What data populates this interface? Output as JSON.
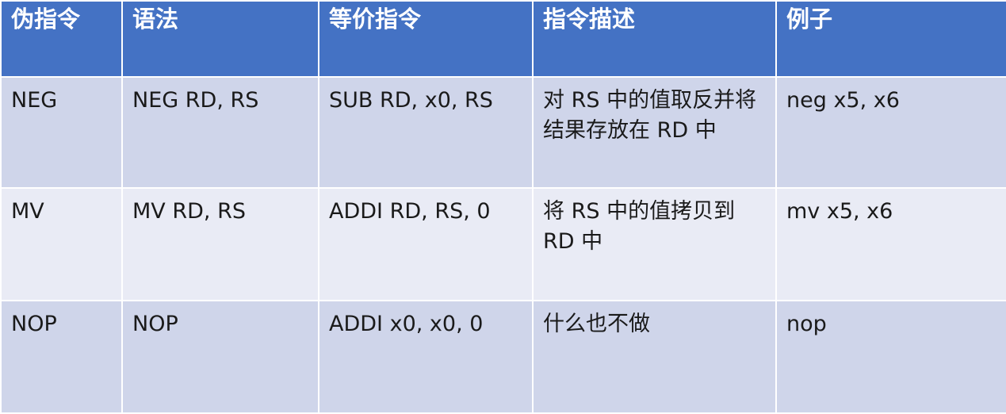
{
  "table": {
    "headers": [
      "伪指令",
      "语法",
      "等价指令",
      "指令描述",
      "例子"
    ],
    "rows": [
      {
        "pseudo": "NEG",
        "syntax": "NEG RD, RS",
        "equivalent": "SUB RD, x0, RS",
        "description": "对 RS 中的值取反并将结果存放在 RD 中",
        "example": "neg x5, x6"
      },
      {
        "pseudo": "MV",
        "syntax": "MV RD, RS",
        "equivalent": "ADDI RD, RS, 0",
        "description": "将 RS 中的值拷贝到 RD 中",
        "example": "mv x5, x6"
      },
      {
        "pseudo": "NOP",
        "syntax": "NOP",
        "equivalent": "ADDI x0, x0, 0",
        "description": "什么也不做",
        "example": "nop"
      }
    ]
  },
  "colors": {
    "header_bg": "#4472c4",
    "row_odd_bg": "#cfd5ea",
    "row_even_bg": "#e9ebf5",
    "header_text": "#ffffff"
  }
}
